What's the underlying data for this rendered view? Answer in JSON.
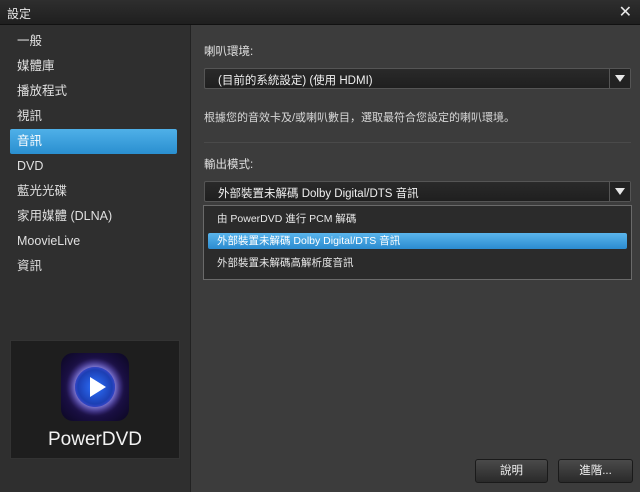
{
  "window": {
    "title": "設定"
  },
  "sidebar": {
    "items": [
      {
        "label": "一般"
      },
      {
        "label": "媒體庫"
      },
      {
        "label": "播放程式"
      },
      {
        "label": "視訊"
      },
      {
        "label": "音訊"
      },
      {
        "label": "DVD"
      },
      {
        "label": "藍光光碟"
      },
      {
        "label": "家用媒體 (DLNA)"
      },
      {
        "label": "MoovieLive"
      },
      {
        "label": "資訊"
      }
    ],
    "active_index": 4,
    "logo_text": "PowerDVD"
  },
  "speaker": {
    "label": "喇叭環境:",
    "selected": "(目前的系統設定) (使用 HDMI)",
    "description": "根據您的音效卡及/或喇叭數目，選取最符合您設定的喇叭環境。"
  },
  "output": {
    "label": "輸出模式:",
    "selected": "外部裝置未解碼 Dolby  Digital/DTS 音訊",
    "options": [
      "由 PowerDVD 進行 PCM 解碼",
      "外部裝置未解碼 Dolby  Digital/DTS 音訊",
      "外部裝置未解碼高解析度音訊"
    ],
    "highlighted_index": 1
  },
  "buttons": {
    "help": "說明",
    "advanced": "進階..."
  },
  "colors": {
    "accent": "#3a9de0",
    "background": "#3c3c3c"
  }
}
